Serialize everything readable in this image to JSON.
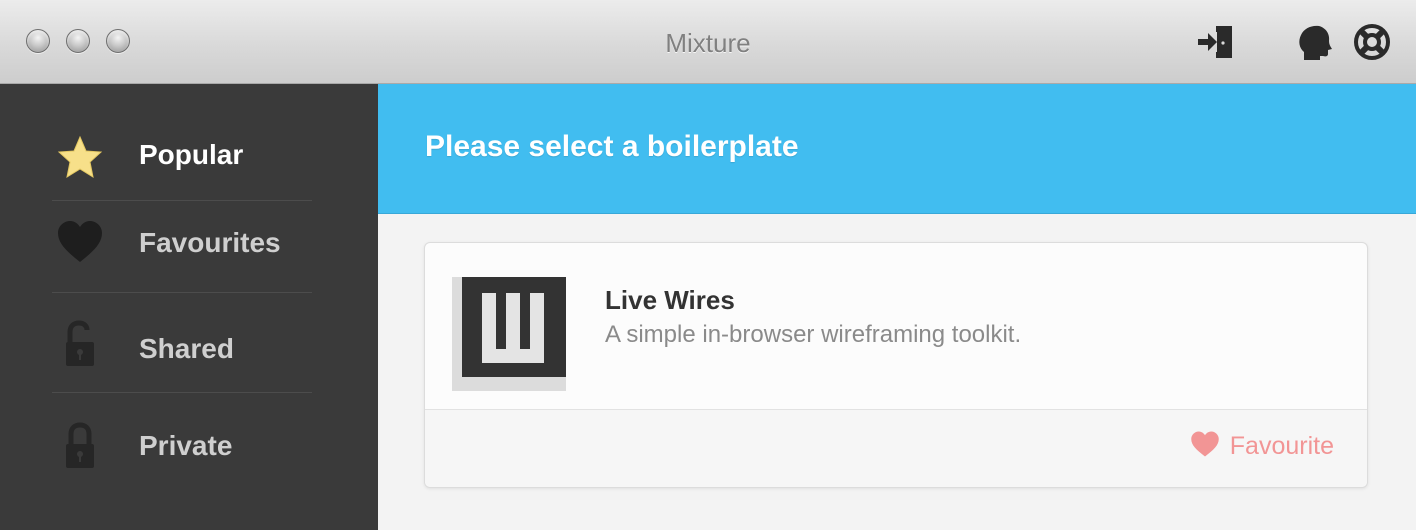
{
  "window": {
    "title": "Mixture",
    "toolbar_icons": [
      "sign-in-icon",
      "head-profile-icon",
      "lifebuoy-icon"
    ]
  },
  "sidebar": {
    "items": [
      {
        "label": "Popular",
        "icon": "star-icon",
        "active": true
      },
      {
        "label": "Favourites",
        "icon": "heart-icon",
        "active": false
      },
      {
        "label": "Shared",
        "icon": "unlocked-padlock-icon",
        "active": false
      },
      {
        "label": "Private",
        "icon": "locked-padlock-icon",
        "active": false
      }
    ]
  },
  "main": {
    "heading": "Please select a boilerplate",
    "boilerplates": [
      {
        "name": "Live Wires",
        "description": "A simple in-browser wireframing toolkit.",
        "logo_icon": "live-wires-logo",
        "favourite_label": "Favourite"
      }
    ]
  },
  "colors": {
    "accent": "#41bdf0",
    "sidebar_bg": "#3a3a3a",
    "star": "#f7e08a",
    "favourite": "#f29595"
  }
}
